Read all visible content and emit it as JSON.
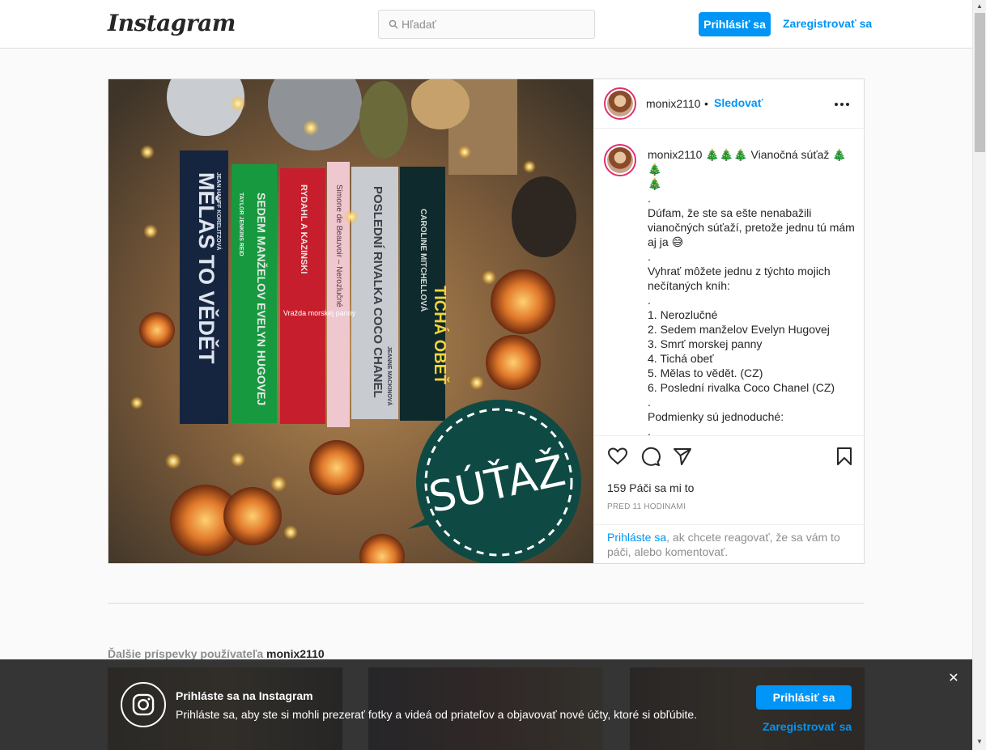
{
  "header": {
    "logo": "Instagram",
    "search_placeholder": "Hľadať",
    "login_label": "Prihlásiť sa",
    "signup_label": "Zaregistrovať sa"
  },
  "post": {
    "username": "monix2110",
    "follow_label": "Sledovať",
    "caption_user": "monix2110",
    "caption_text": " 🎄🎄🎄 Vianočná súťaž 🎄🎄\n🎄\n.\nDúfam, že ste sa ešte nenabažili vianočných súťaží, pretože jednu tú mám aj ja 😅\n.\nVyhrať môžete jednu z týchto mojich nečítaných kníh:\n.\n1. Nerozlučné\n2. Sedem manželov Evelyn Hugovej\n3. Smrť morskej panny\n4. Tichá obeť\n5. Mělas to vědět. (CZ)\n6. Poslední rivalka Coco Chanel (CZ)\n.\nPodmienky sú jednoduché:\n.\n- napíšte do komentára, o ktorú knihu",
    "likes": "159 Páči sa mi to",
    "time": "PRED 11 HODINAMI",
    "login_link": "Prihláste sa",
    "login_note": ", ak chcete reagovať, že sa vám to páči, alebo komentovať.",
    "image": {
      "book_titles": [
        "MĚLAS TO VĚDĚT",
        "SEDEM MANŽELOV EVELYN HUGOVEJ",
        "Vražda morskej panny",
        "Simone de Beauvoir – Nerozlučné",
        "POSLEDNÍ RIVALKA COCO CHANEL",
        "TICHÁ OBEŤ"
      ],
      "book_authors": [
        "JEAN HANFF KORELITZOVÁ",
        "TAYLOR JENKINS REID",
        "RYDAHL A KAZINSKI",
        "",
        "JEANNE MACKINOVÁ",
        "CAROLINE MITCHELLOVÁ"
      ],
      "badge": "SÚŤAŽ"
    }
  },
  "more_posts": {
    "prefix": "Ďalšie príspevky používateľa ",
    "username": "monix2110"
  },
  "banner": {
    "title": "Prihláste sa na Instagram",
    "text": "Prihláste sa, aby ste si mohli prezerať fotky a videá od priateľov a objavovať nové účty, ktoré si obľúbite.",
    "login_label": "Prihlásiť sa",
    "signup_label": "Zaregistrovať sa",
    "close": "✕"
  },
  "colors": {
    "accent": "#0095f6",
    "banner_bg": "#262626",
    "badge_green": "#0e4a43"
  }
}
